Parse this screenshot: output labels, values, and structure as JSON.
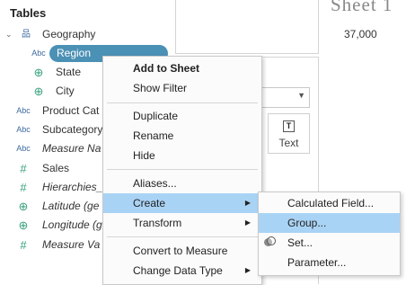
{
  "data_pane": {
    "title": "Tables",
    "folder": {
      "caret": "⌄",
      "icon": "品",
      "label": "Geography"
    },
    "fields": [
      {
        "type": "Abc",
        "label": "Region"
      },
      {
        "type": "⊕",
        "label": "State"
      },
      {
        "type": "⊕",
        "label": "City"
      },
      {
        "type": "Abc",
        "label": "Product Cat"
      },
      {
        "type": "Abc",
        "label": "Subcategory"
      },
      {
        "type": "Abc",
        "label": "Measure Na"
      },
      {
        "type": "#",
        "label": "Sales"
      },
      {
        "type": "#",
        "label": "Hierarchies_"
      },
      {
        "type": "⊕",
        "label": "Latitude (ge"
      },
      {
        "type": "⊕",
        "label": "Longitude (g"
      },
      {
        "type": "#",
        "label": "Measure Va"
      }
    ]
  },
  "marks_card": {
    "text_button_label": "Text",
    "text_icon": "T"
  },
  "sheet": {
    "title": "Sheet 1",
    "value": "37,000"
  },
  "context_menu": {
    "items": [
      {
        "label": "Add to Sheet"
      },
      {
        "label": "Show Filter"
      },
      {
        "label": "Duplicate"
      },
      {
        "label": "Rename"
      },
      {
        "label": "Hide"
      },
      {
        "label": "Aliases..."
      },
      {
        "label": "Create",
        "submenu_arrow": "▶"
      },
      {
        "label": "Transform",
        "submenu_arrow": "▶"
      },
      {
        "label": "Convert to Measure"
      },
      {
        "label": "Change Data Type",
        "submenu_arrow": "▶"
      }
    ],
    "highlighted": "Create"
  },
  "create_submenu": {
    "items": [
      {
        "label": "Calculated Field..."
      },
      {
        "label": "Group..."
      },
      {
        "label": "Set..."
      },
      {
        "label": "Parameter..."
      }
    ],
    "highlighted": "Group..."
  },
  "colors": {
    "highlight": "#a9d3f5",
    "region_pill": "#4b90b5",
    "dimension_icon": "#3f6aa0",
    "geo_icon": "#38a27a"
  }
}
